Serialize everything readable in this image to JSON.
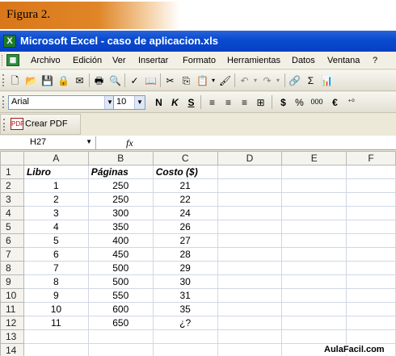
{
  "figure_label": "Figura 2.",
  "window": {
    "title": "Microsoft Excel - caso de aplicacion.xls",
    "app_icon": "excel-icon"
  },
  "menu": [
    {
      "label": "Archivo"
    },
    {
      "label": "Edición"
    },
    {
      "label": "Ver"
    },
    {
      "label": "Insertar"
    },
    {
      "label": "Formato"
    },
    {
      "label": "Herramientas"
    },
    {
      "label": "Datos"
    },
    {
      "label": "Ventana"
    },
    {
      "label": "?"
    }
  ],
  "formatting": {
    "font": "Arial",
    "size": "10",
    "bold": "N",
    "italic": "K",
    "underline": "S",
    "currency": "$",
    "percent": "%",
    "thousands": "000",
    "euro": "€",
    "increase_decimals": "⁺⁰"
  },
  "crear_pdf": "Crear PDF",
  "name_box": "H27",
  "fx_label": "fx",
  "columns": [
    "A",
    "B",
    "C",
    "D",
    "E",
    "F"
  ],
  "rows": [
    {
      "n": "1",
      "a": "Libro",
      "b": "Páginas",
      "c": "Costo ($)",
      "header": true
    },
    {
      "n": "2",
      "a": "1",
      "b": "250",
      "c": "21"
    },
    {
      "n": "3",
      "a": "2",
      "b": "250",
      "c": "22"
    },
    {
      "n": "4",
      "a": "3",
      "b": "300",
      "c": "24"
    },
    {
      "n": "5",
      "a": "4",
      "b": "350",
      "c": "26"
    },
    {
      "n": "6",
      "a": "5",
      "b": "400",
      "c": "27"
    },
    {
      "n": "7",
      "a": "6",
      "b": "450",
      "c": "28"
    },
    {
      "n": "8",
      "a": "7",
      "b": "500",
      "c": "29"
    },
    {
      "n": "9",
      "a": "8",
      "b": "500",
      "c": "30"
    },
    {
      "n": "10",
      "a": "9",
      "b": "550",
      "c": "31"
    },
    {
      "n": "11",
      "a": "10",
      "b": "600",
      "c": "35"
    },
    {
      "n": "12",
      "a": "11",
      "b": "650",
      "c": "¿?"
    },
    {
      "n": "13",
      "a": "",
      "b": "",
      "c": ""
    },
    {
      "n": "14",
      "a": "",
      "b": "",
      "c": ""
    }
  ],
  "footer": "AulaFacil.com"
}
